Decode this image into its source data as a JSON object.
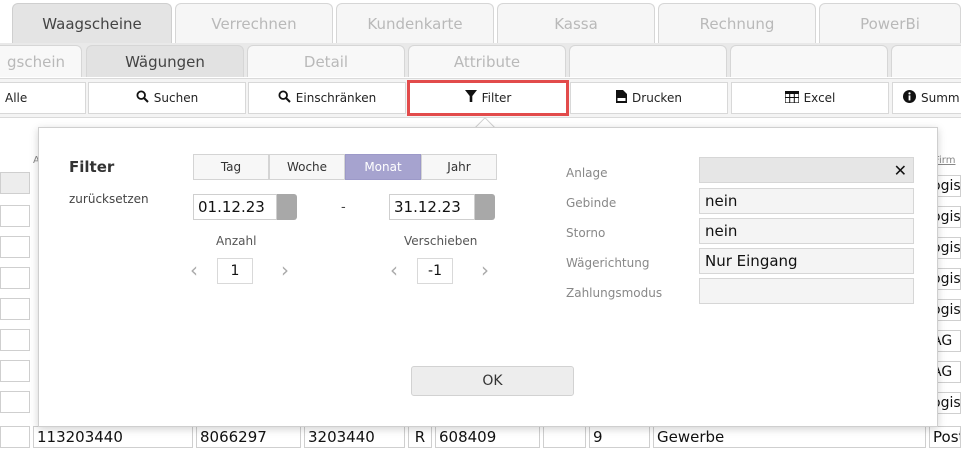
{
  "tabs_row1": [
    {
      "label": "Waagscheine",
      "active": true
    },
    {
      "label": "Verrechnen",
      "active": false
    },
    {
      "label": "Kundenkarte",
      "active": false
    },
    {
      "label": "Kassa",
      "active": false
    },
    {
      "label": "Rechnung",
      "active": false
    },
    {
      "label": "PowerBi",
      "active": false
    }
  ],
  "tabs_row2": [
    {
      "label": "gschein",
      "active": false
    },
    {
      "label": "Wägungen",
      "active": true
    },
    {
      "label": "Detail",
      "active": false
    },
    {
      "label": "Attribute",
      "active": false
    }
  ],
  "toolbar": {
    "alle": "Alle",
    "suchen": "Suchen",
    "einschraenken": "Einschränken",
    "filter": "Filter",
    "drucken": "Drucken",
    "excel": "Excel",
    "summe": "Summ"
  },
  "icons": {
    "search": "search-icon",
    "funnel": "funnel-icon",
    "pdf": "pdf-icon",
    "table": "table-icon",
    "info": "info-icon"
  },
  "grid": {
    "header_a": "A",
    "header_firm": "Firm",
    "right_column": [
      "ogis",
      "ogis",
      "ogis",
      "ogis",
      "ogis",
      "AG",
      "AG",
      "ogis"
    ],
    "last_row": [
      "113203440",
      "8066297",
      "3203440",
      "R",
      "608409",
      "",
      "9",
      "Gewerbe",
      "PostLogis"
    ]
  },
  "filter": {
    "title": "Filter",
    "reset": "zurücksetzen",
    "periods": [
      "Tag",
      "Woche",
      "Monat",
      "Jahr"
    ],
    "active_period": "Monat",
    "date_from": "01.12.23",
    "date_to": "31.12.23",
    "separator": "-",
    "anzahl_label": "Anzahl",
    "anzahl_value": "1",
    "verschieben_label": "Verschieben",
    "verschieben_value": "-1",
    "fields": [
      {
        "label": "Anlage",
        "value": ""
      },
      {
        "label": "Gebinde",
        "value": "nein"
      },
      {
        "label": "Storno",
        "value": "nein"
      },
      {
        "label": "Wägerichtung",
        "value": "Nur Eingang"
      },
      {
        "label": "Zahlungsmodus",
        "value": ""
      }
    ],
    "ok": "OK",
    "clear": "✕"
  },
  "colors": {
    "active_segment": "#a6a3cf",
    "highlight": "#e24b4b"
  }
}
